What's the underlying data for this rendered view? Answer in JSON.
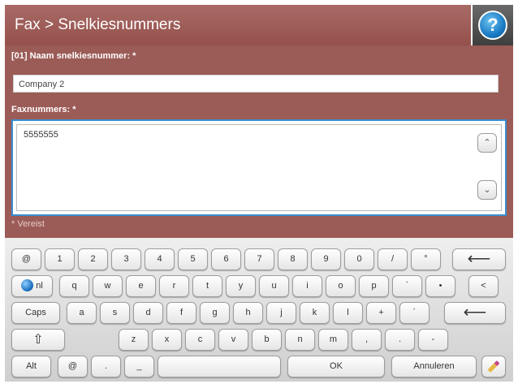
{
  "header": {
    "title": "Fax > Snelkiesnummers",
    "help_label": "?"
  },
  "form": {
    "name_label": "[01] Naam snelkiesnummer: *",
    "name_value": "Company 2",
    "fax_label": "Faxnummers: *",
    "fax_numbers": [
      "5555555"
    ],
    "required_note": "* Vereist",
    "scroll_up": "⌃",
    "scroll_down": "⌄"
  },
  "keyboard": {
    "row1": [
      "@",
      "1",
      "2",
      "3",
      "4",
      "5",
      "6",
      "7",
      "8",
      "9",
      "0",
      "/",
      "°"
    ],
    "backspace": "⟵",
    "language": "nl",
    "row2": [
      "q",
      "w",
      "e",
      "r",
      "t",
      "y",
      "u",
      "i",
      "o",
      "p",
      "`",
      "•",
      "<"
    ],
    "caps": "Caps",
    "row3": [
      "a",
      "s",
      "d",
      "f",
      "g",
      "h",
      "j",
      "k",
      "l",
      "+",
      "´"
    ],
    "enter": "⟵",
    "shift": "⇧",
    "row4": [
      "z",
      "x",
      "c",
      "v",
      "b",
      "n",
      "m",
      ",",
      ".",
      "-"
    ],
    "alt": "Alt",
    "at": "@",
    "dot": ".",
    "underscore": "_",
    "space": "",
    "ok": "OK",
    "cancel": "Annuleren",
    "edit_icon": "pencil-icon"
  }
}
